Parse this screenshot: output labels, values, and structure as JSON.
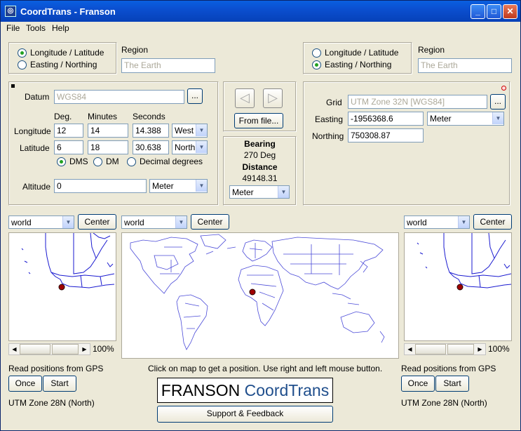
{
  "window": {
    "title": "CoordTrans - Franson",
    "minimize": "_",
    "maximize": "□",
    "close": "✕",
    "app_icon": "globe-icon"
  },
  "menu": {
    "file": "File",
    "tools": "Tools",
    "help": "Help"
  },
  "left": {
    "mode_lonlat": "Longitude / Latitude",
    "mode_easting": "Easting / Northing",
    "region_label": "Region",
    "region_value": "The Earth",
    "datum_label": "Datum",
    "datum_value": "WGS84",
    "datum_browse": "...",
    "col_deg": "Deg.",
    "col_minutes": "Minutes",
    "col_seconds": "Seconds",
    "lon_label": "Longitude",
    "lon_deg": "12",
    "lon_min": "14",
    "lon_sec": "14.388",
    "lon_dir": "West",
    "lat_label": "Latitude",
    "lat_deg": "6",
    "lat_min": "18",
    "lat_sec": "30.638",
    "lat_dir": "North",
    "fmt_dms": "DMS",
    "fmt_dm": "DM",
    "fmt_dd": "Decimal degrees",
    "alt_label": "Altitude",
    "alt_value": "0",
    "alt_unit": "Meter"
  },
  "middle": {
    "from_file": "From file...",
    "bearing_label": "Bearing",
    "bearing_value": "270 Deg",
    "distance_label": "Distance",
    "distance_value": "49148.31",
    "distance_unit": "Meter"
  },
  "right": {
    "mode_lonlat": "Longitude / Latitude",
    "mode_easting": "Easting / Northing",
    "region_label": "Region",
    "region_value": "The Earth",
    "grid_label": "Grid",
    "grid_value": "UTM Zone 32N [WGS84]",
    "grid_browse": "...",
    "easting_label": "Easting",
    "easting_value": "-1956368.6",
    "easting_unit": "Meter",
    "northing_label": "Northing",
    "northing_value": "750308.87"
  },
  "maps": {
    "left_select": "world",
    "center_label": "Center",
    "mid_select": "world",
    "right_select": "world",
    "zoom_left": "100%",
    "zoom_right": "100%",
    "hint": "Click on map to get a position. Use right and left mouse button."
  },
  "gps": {
    "left_label": "Read positions from GPS",
    "once": "Once",
    "start": "Start",
    "left_zone": "UTM Zone 28N (North)",
    "right_label": "Read positions from GPS",
    "right_zone": "UTM Zone 28N (North)"
  },
  "logo": {
    "brand": "FRANSON",
    "product": "CoordTrans"
  },
  "support": "Support & Feedback"
}
